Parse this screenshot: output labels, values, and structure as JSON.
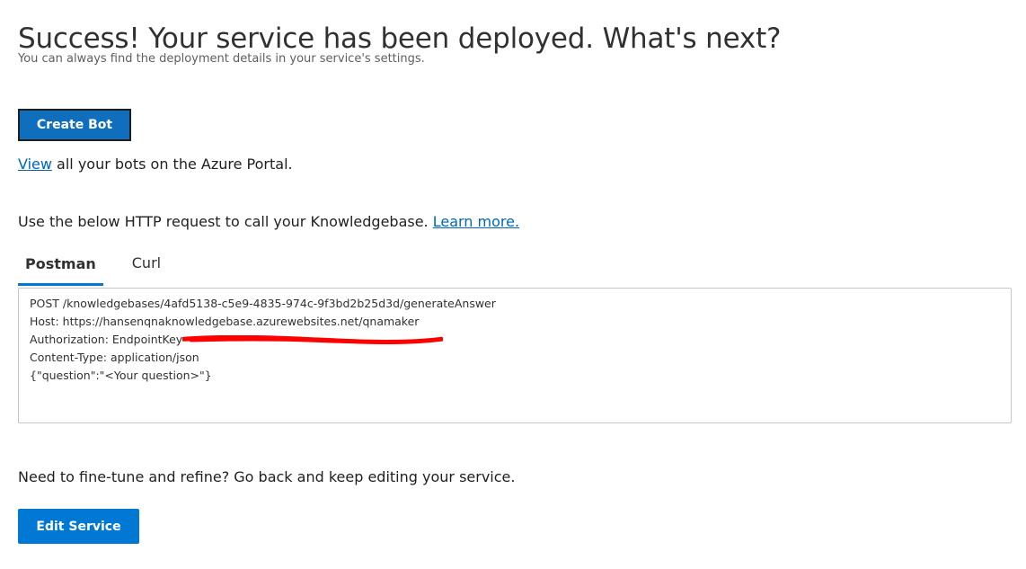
{
  "header": {
    "title": "Success! Your service has been deployed. What's next?",
    "subtitle": "You can always find the deployment details in your service's settings."
  },
  "bot": {
    "create_label": "Create Bot",
    "view_link": "View",
    "view_rest": " all your bots on the Azure Portal."
  },
  "http": {
    "intro": "Use the below HTTP request to call your Knowledgebase. ",
    "learn_more": "Learn more.",
    "tabs": [
      {
        "label": "Postman",
        "active": true
      },
      {
        "label": "Curl",
        "active": false
      }
    ],
    "code_lines": [
      "POST /knowledgebases/4afd5138-c5e9-4835-974c-9f3bd2b25d3d/generateAnswer",
      "Host: https://hansenqnaknowledgebase.azurewebsites.net/qnamaker",
      "Authorization: EndpointKey",
      "Content-Type: application/json",
      "{\"question\":\"<Your question>\"}"
    ],
    "redaction_color": "#ff0000"
  },
  "finetune": {
    "text": "Need to fine-tune and refine? Go back and keep editing your service.",
    "edit_label": "Edit Service"
  },
  "colors": {
    "accent": "#0078d4",
    "link": "#0067b8"
  }
}
